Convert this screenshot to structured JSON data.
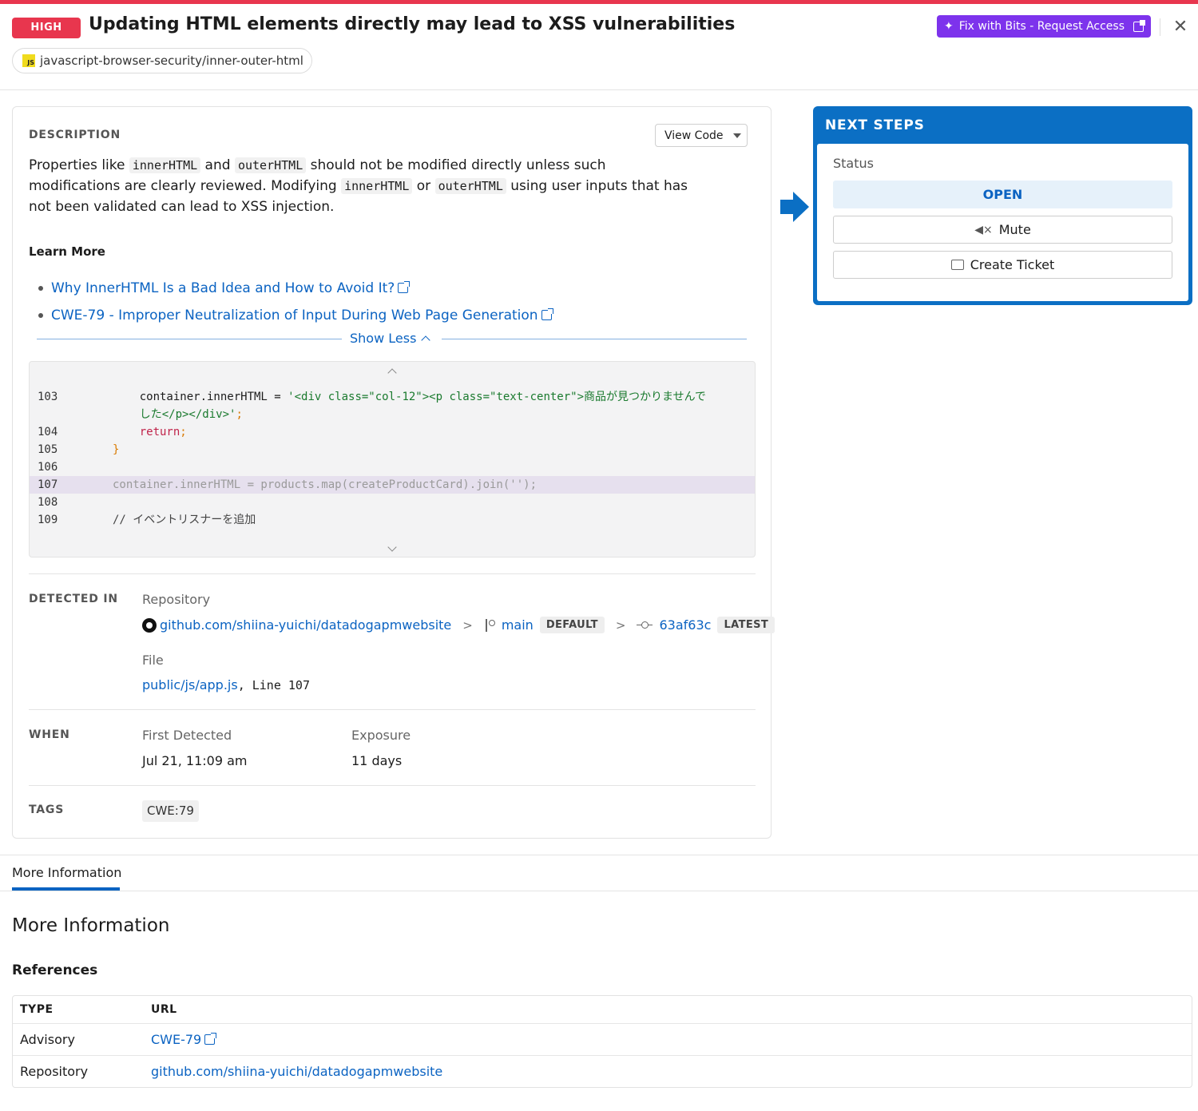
{
  "header": {
    "severity": "HIGH",
    "title": "Updating HTML elements directly may lead to XSS vulnerabilities",
    "rule_icon": "JS",
    "rule_id": "javascript-browser-security/inner-outer-html",
    "fix_button": "Fix with Bits - Request Access",
    "close": "✕"
  },
  "description": {
    "label": "DESCRIPTION",
    "view_code": "View Code",
    "text": {
      "p1": "Properties like ",
      "c1": "innerHTML",
      "p2": " and ",
      "c2": "outerHTML",
      "p3": " should not be modified directly unless such modifications are clearly reviewed. Modifying ",
      "c3": "innerHTML",
      "p4": " or ",
      "c4": "outerHTML",
      "p5": " using user inputs that has not been validated can lead to XSS injection."
    },
    "learn_more": "Learn More",
    "links": [
      "Why InnerHTML Is a Bad Idea and How to Avoid It?",
      "CWE-79 - Improper Neutralization of Input During Web Page Generation"
    ],
    "show_less": "Show Less"
  },
  "code": {
    "lines": [
      {
        "num": "103",
        "a": "    container.innerHTML = ",
        "b": "'<div class=\"col-12\"><p class=\"text-center\">商品が見つかりませんで",
        "c": ""
      },
      {
        "num": "",
        "a": "    ",
        "b": "した</p></div>'",
        "c": ";"
      },
      {
        "num": "104",
        "a": "    ",
        "b": "return",
        "c": ";"
      },
      {
        "num": "105",
        "a": "",
        "b": "}",
        "c": ""
      },
      {
        "num": "106",
        "a": "",
        "b": "",
        "c": ""
      },
      {
        "num": "107",
        "a": "container.innerHTML = products.map(createProductCard).join('');",
        "b": "",
        "c": ""
      },
      {
        "num": "108",
        "a": "",
        "b": "",
        "c": ""
      },
      {
        "num": "109",
        "a": "// イベントリスナーを追加",
        "b": "",
        "c": ""
      }
    ]
  },
  "detected": {
    "label": "DETECTED IN",
    "repo_label": "Repository",
    "repo": "github.com/shiina-yuichi/datadogapmwebsite",
    "branch": "main",
    "branch_tag": "DEFAULT",
    "commit": "63af63c",
    "commit_tag": "LATEST",
    "file_label": "File",
    "file": "public/js/app.js",
    "line": ", Line 107"
  },
  "when": {
    "label": "WHEN",
    "first_label": "First Detected",
    "first_value": "Jul 21, 11:09 am",
    "exposure_label": "Exposure",
    "exposure_value": "11 days"
  },
  "tags": {
    "label": "TAGS",
    "items": [
      "CWE:79"
    ]
  },
  "next_steps": {
    "title": "NEXT STEPS",
    "status_label": "Status",
    "status": "OPEN",
    "mute": "Mute",
    "ticket": "Create Ticket"
  },
  "more_info": {
    "tab": "More Information",
    "heading": "More Information",
    "references": "References",
    "columns": [
      "TYPE",
      "URL"
    ],
    "rows": [
      {
        "type": "Advisory",
        "url": "CWE-79"
      },
      {
        "type": "Repository",
        "url": "github.com/shiina-yuichi/datadogapmwebsite"
      }
    ]
  },
  "colors": {
    "severity_red": "#e8364e",
    "bits_purple": "#7d33ec",
    "primary_blue": "#0b6fc4",
    "link_blue": "#0b63c2"
  }
}
